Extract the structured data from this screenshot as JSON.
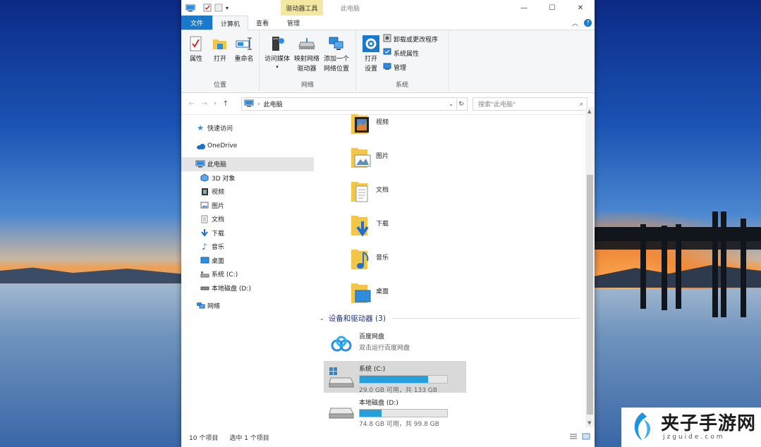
{
  "window": {
    "title": "此电脑",
    "context_tab": "驱动器工具",
    "controls": {
      "minimize": "—",
      "maximize": "☐",
      "close": "✕"
    }
  },
  "tabs": [
    {
      "label": "文件"
    },
    {
      "label": "计算机"
    },
    {
      "label": "查看"
    },
    {
      "label": "管理"
    }
  ],
  "ribbon": {
    "location": {
      "group_label": "位置",
      "properties": "属性",
      "open": "打开",
      "rename": "重命名"
    },
    "network": {
      "group_label": "网络",
      "access_media": "访问媒体",
      "map_drive_l1": "映射网络",
      "map_drive_l2": "驱动器",
      "add_location_l1": "添加一个",
      "add_location_l2": "网络位置"
    },
    "system": {
      "group_label": "系统",
      "open_settings_l1": "打开",
      "open_settings_l2": "设置",
      "uninstall": "卸载或更改程序",
      "system_properties": "系统属性",
      "manage": "管理"
    }
  },
  "address": {
    "path": "此电脑",
    "search_placeholder": "搜索\"此电脑\""
  },
  "nav": {
    "quick_access": "快速访问",
    "onedrive": "OneDrive",
    "this_pc": "此电脑",
    "objects3d": "3D 对象",
    "videos": "视频",
    "pictures": "图片",
    "documents": "文档",
    "downloads": "下载",
    "music": "音乐",
    "desktop": "桌面",
    "system_c": "系统 (C:)",
    "local_d": "本地磁盘 (D:)",
    "network": "网络"
  },
  "folders": [
    "视频",
    "图片",
    "文档",
    "下载",
    "音乐",
    "桌面"
  ],
  "devices_header": "设备和驱动器 (3)",
  "drives": [
    {
      "name": "百度网盘",
      "sub": "双击运行百度网盘"
    },
    {
      "name": "系统 (C:)",
      "sub": "29.0 GB 可用，共 133 GB",
      "used_fraction": 0.78
    },
    {
      "name": "本地磁盘 (D:)",
      "sub": "74.8 GB 可用，共 99.8 GB",
      "used_fraction": 0.25
    }
  ],
  "status": {
    "items": "10 个项目",
    "selected": "选中 1 个项目"
  },
  "watermark": {
    "title": "夹子手游网",
    "sub": "jzguide.com"
  },
  "colors": {
    "accent": "#1979ca",
    "drive_bar": "#26a0da",
    "context_tab": "#f3e7a2"
  }
}
